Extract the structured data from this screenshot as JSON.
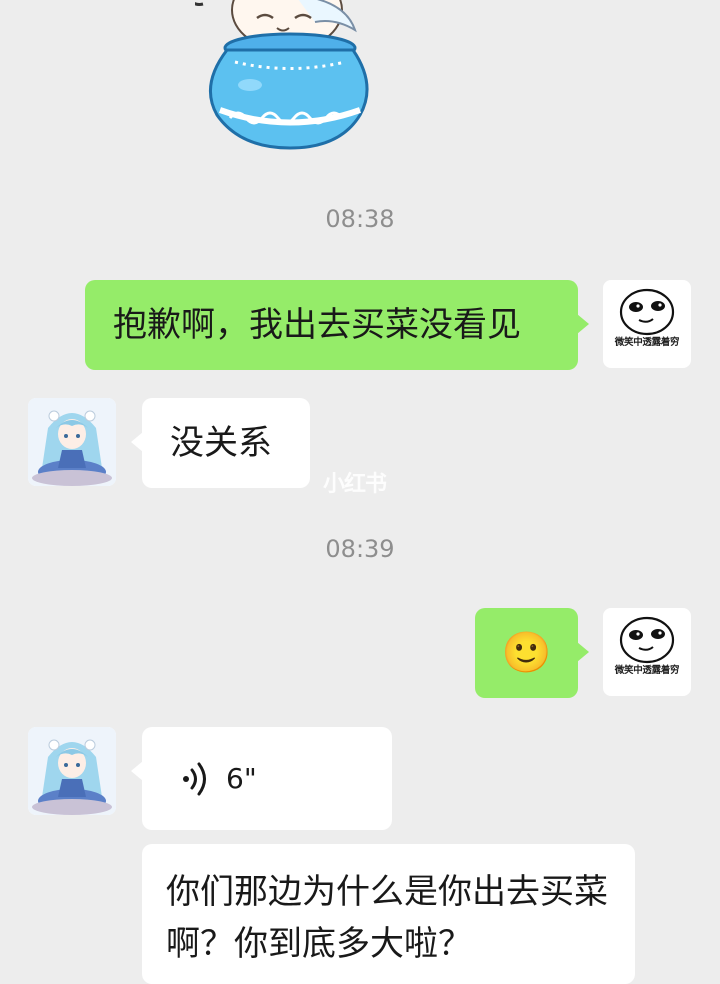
{
  "chat": {
    "timestamp_1": "08:38",
    "timestamp_2": "08:39",
    "msg_sent_1": "抱歉啊，我出去买菜没看见",
    "msg_recv_1": "没关系",
    "msg_sent_2_emoji": "🙂",
    "voice_duration": "6\"",
    "msg_recv_3": "你们那边为什么是你出去买菜啊？你到底多大啦？"
  },
  "self_avatar": {
    "caption": "微笑中透露着穷",
    "icon": "smiling-face-meme-icon"
  },
  "contact_avatar": {
    "icon": "anime-girl-avatar"
  },
  "sticker": {
    "icon": "character-in-blue-jar-sticker"
  },
  "watermark": "小红书",
  "colors": {
    "background": "#ededed",
    "sent_bubble": "#95ec69",
    "received_bubble": "#ffffff",
    "timestamp": "#8e8e8e"
  }
}
